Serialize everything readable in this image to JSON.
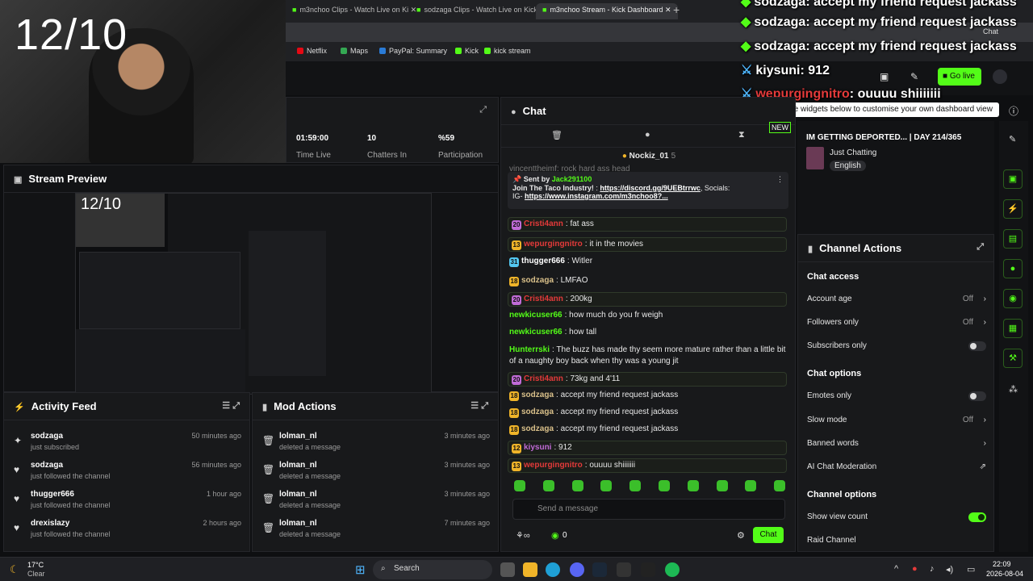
{
  "webcam": {
    "counter": "12/10"
  },
  "browser": {
    "tabs": [
      "m3nchoo Clips - Watch Live on Ki",
      "sodzaga Clips - Watch Live on Kick",
      "m3nchoo Stream - Kick Dashboard"
    ],
    "new_tab": "+",
    "bookmarks": [
      "Netflix",
      "Maps",
      "PayPal: Summary",
      "Kick",
      "kick stream"
    ],
    "profile": "Chat"
  },
  "topbar": {
    "go_live": "Go live"
  },
  "overlay": [
    {
      "user": "sodzaga",
      "text": "accept my friend request jackass",
      "type": "green",
      "cut": true
    },
    {
      "user": "sodzaga",
      "text": "accept my friend request jackass",
      "type": "green"
    },
    {
      "user": "sodzaga",
      "text": "accept my friend request jackass",
      "type": "green"
    },
    {
      "user": "kiysuni",
      "text": "912",
      "type": "blue"
    },
    {
      "user": "wepurgingnitro",
      "text": "ouuuu shiiiiiii",
      "type": "red"
    }
  ],
  "tooltip": "Drag or click the widgets below to customise your own dashboard view",
  "stats": {
    "time_live": "01:59:00",
    "time_live_label": "Time Live",
    "chatters": "10",
    "chatters_label": "Chatters In",
    "participation": "%59",
    "participation_label": "Participation"
  },
  "preview": {
    "title": "Stream Preview",
    "inner_counter": "12/10"
  },
  "activity_feed": {
    "title": "Activity Feed",
    "items": [
      {
        "user": "sodzaga",
        "action": "just subscribed",
        "time": "50 minutes ago",
        "icon": "subscribe-icon"
      },
      {
        "user": "sodzaga",
        "action": "just followed the channel",
        "time": "56 minutes ago",
        "icon": "heart-icon"
      },
      {
        "user": "thugger666",
        "action": "just followed the channel",
        "time": "1 hour ago",
        "icon": "heart-icon"
      },
      {
        "user": "drexislazy",
        "action": "just followed the channel",
        "time": "2 hours ago",
        "icon": "heart-icon"
      }
    ]
  },
  "mod_actions": {
    "title": "Mod Actions",
    "items": [
      {
        "user": "lolman_nl",
        "action": "deleted a message",
        "time": "3 minutes ago"
      },
      {
        "user": "lolman_nl",
        "action": "deleted a message",
        "time": "3 minutes ago"
      },
      {
        "user": "lolman_nl",
        "action": "deleted a message",
        "time": "3 minutes ago"
      },
      {
        "user": "lolman_nl",
        "action": "deleted a message",
        "time": "7 minutes ago"
      }
    ]
  },
  "chat": {
    "title": "Chat",
    "new_label": "NEW",
    "top_user": "Nockiz_01",
    "top_user_count": "5",
    "partial_line": "vincenttheimf: rock hard ass head",
    "pinned": {
      "sent_by_label": "Sent by",
      "sent_by": "Jack291100",
      "text_a": "Join The Taco Industry!",
      "link_a": "https://discord.gg/9UEBtrrwc",
      "text_b": ", Socials:",
      "text_c": "IG-",
      "link_b": "https://www.instagram.com/m3nchoo8?..."
    },
    "messages": [
      {
        "badge": "20",
        "badge_color": "#c06bd6",
        "user": "Cristi4ann",
        "user_color": "#e43a3a",
        "text": "fat ass",
        "hl": true
      },
      {
        "badge": "13",
        "badge_color": "#f0b429",
        "user": "wepurgingnitro",
        "user_color": "#e43a3a",
        "text": "it in the movies",
        "hl": true
      },
      {
        "badge": "31",
        "badge_color": "#53c7f0",
        "user": "thugger666",
        "user_color": "#ffffff",
        "text": "Witler",
        "hl": false
      },
      {
        "badge": "18",
        "badge_color": "#f0b429",
        "user": "sodzaga",
        "user_color": "#d9c08a",
        "text": "LMFAO",
        "hl": false
      },
      {
        "badge": "20",
        "badge_color": "#c06bd6",
        "user": "Cristi4ann",
        "user_color": "#e43a3a",
        "text": "200kg",
        "hl": true
      },
      {
        "badge": "",
        "badge_color": "",
        "user": "newkicuser66",
        "user_color": "#53fc18",
        "text": "how much do you fr weigh",
        "hl": false
      },
      {
        "badge": "",
        "badge_color": "",
        "user": "newkicuser66",
        "user_color": "#53fc18",
        "text": "how tall",
        "hl": false
      },
      {
        "badge": "",
        "badge_color": "",
        "user": "Hunterrski",
        "user_color": "#53fc18",
        "text": "The buzz has made thy seem more mature rather than a little bit of a naughty boy back when thy was a young jit",
        "hl": false
      },
      {
        "badge": "20",
        "badge_color": "#c06bd6",
        "user": "Cristi4ann",
        "user_color": "#e43a3a",
        "text": "73kg and 4'11",
        "hl": true
      },
      {
        "badge": "18",
        "badge_color": "#f0b429",
        "user": "sodzaga",
        "user_color": "#d9c08a",
        "text": "accept my friend request jackass",
        "hl": false
      },
      {
        "badge": "18",
        "badge_color": "#f0b429",
        "user": "sodzaga",
        "user_color": "#d9c08a",
        "text": "accept my friend request jackass",
        "hl": false
      },
      {
        "badge": "18",
        "badge_color": "#f0b429",
        "user": "sodzaga",
        "user_color": "#d9c08a",
        "text": "accept my friend request jackass",
        "hl": false
      },
      {
        "badge": "12",
        "badge_color": "#f0b429",
        "user": "kiysuni",
        "user_color": "#c06bd6",
        "text": "912",
        "hl": true
      },
      {
        "badge": "13",
        "badge_color": "#f0b429",
        "user": "wepurgingnitro",
        "user_color": "#e43a3a",
        "text": "ouuuu shiiiiiii",
        "hl": true
      }
    ],
    "input_placeholder": "Send a message",
    "points": "0",
    "send_label": "Chat"
  },
  "stream_info": {
    "title": "IM GETTING DEPORTED... | DAY 214/365",
    "category": "Just Chatting",
    "language": "English"
  },
  "channel_actions": {
    "title": "Channel Actions",
    "chat_access": "Chat access",
    "account_age": "Account age",
    "account_age_val": "Off",
    "followers_only": "Followers only",
    "followers_only_val": "Off",
    "subscribers_only": "Subscribers only",
    "chat_options": "Chat options",
    "emotes_only": "Emotes only",
    "slow_mode": "Slow mode",
    "slow_mode_val": "Off",
    "banned_words": "Banned words",
    "ai_mod": "AI Chat Moderation",
    "channel_options": "Channel options",
    "show_view_count": "Show view count",
    "raid_channel": "Raid Channel"
  },
  "taskbar": {
    "weather_temp": "17°C",
    "weather_desc": "Clear",
    "search": "Search",
    "time": "22:09",
    "date": "2026-08-04"
  }
}
